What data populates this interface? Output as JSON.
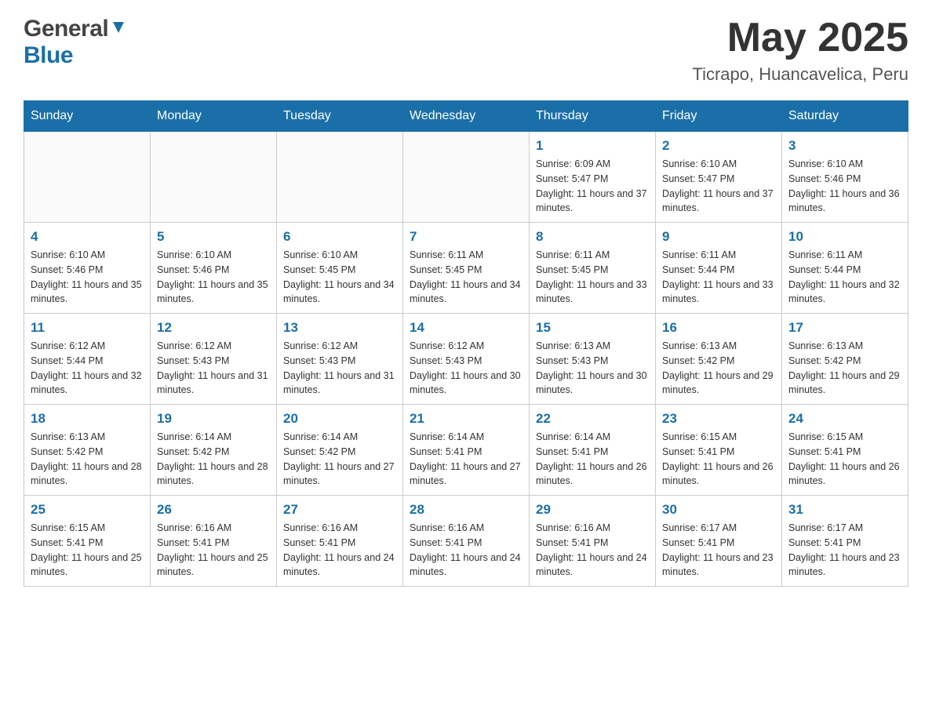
{
  "header": {
    "logo_general": "General",
    "logo_blue": "Blue",
    "month_title": "May 2025",
    "location": "Ticrapo, Huancavelica, Peru"
  },
  "days_of_week": [
    "Sunday",
    "Monday",
    "Tuesday",
    "Wednesday",
    "Thursday",
    "Friday",
    "Saturday"
  ],
  "weeks": [
    [
      {
        "day": "",
        "info": ""
      },
      {
        "day": "",
        "info": ""
      },
      {
        "day": "",
        "info": ""
      },
      {
        "day": "",
        "info": ""
      },
      {
        "day": "1",
        "info": "Sunrise: 6:09 AM\nSunset: 5:47 PM\nDaylight: 11 hours and 37 minutes."
      },
      {
        "day": "2",
        "info": "Sunrise: 6:10 AM\nSunset: 5:47 PM\nDaylight: 11 hours and 37 minutes."
      },
      {
        "day": "3",
        "info": "Sunrise: 6:10 AM\nSunset: 5:46 PM\nDaylight: 11 hours and 36 minutes."
      }
    ],
    [
      {
        "day": "4",
        "info": "Sunrise: 6:10 AM\nSunset: 5:46 PM\nDaylight: 11 hours and 35 minutes."
      },
      {
        "day": "5",
        "info": "Sunrise: 6:10 AM\nSunset: 5:46 PM\nDaylight: 11 hours and 35 minutes."
      },
      {
        "day": "6",
        "info": "Sunrise: 6:10 AM\nSunset: 5:45 PM\nDaylight: 11 hours and 34 minutes."
      },
      {
        "day": "7",
        "info": "Sunrise: 6:11 AM\nSunset: 5:45 PM\nDaylight: 11 hours and 34 minutes."
      },
      {
        "day": "8",
        "info": "Sunrise: 6:11 AM\nSunset: 5:45 PM\nDaylight: 11 hours and 33 minutes."
      },
      {
        "day": "9",
        "info": "Sunrise: 6:11 AM\nSunset: 5:44 PM\nDaylight: 11 hours and 33 minutes."
      },
      {
        "day": "10",
        "info": "Sunrise: 6:11 AM\nSunset: 5:44 PM\nDaylight: 11 hours and 32 minutes."
      }
    ],
    [
      {
        "day": "11",
        "info": "Sunrise: 6:12 AM\nSunset: 5:44 PM\nDaylight: 11 hours and 32 minutes."
      },
      {
        "day": "12",
        "info": "Sunrise: 6:12 AM\nSunset: 5:43 PM\nDaylight: 11 hours and 31 minutes."
      },
      {
        "day": "13",
        "info": "Sunrise: 6:12 AM\nSunset: 5:43 PM\nDaylight: 11 hours and 31 minutes."
      },
      {
        "day": "14",
        "info": "Sunrise: 6:12 AM\nSunset: 5:43 PM\nDaylight: 11 hours and 30 minutes."
      },
      {
        "day": "15",
        "info": "Sunrise: 6:13 AM\nSunset: 5:43 PM\nDaylight: 11 hours and 30 minutes."
      },
      {
        "day": "16",
        "info": "Sunrise: 6:13 AM\nSunset: 5:42 PM\nDaylight: 11 hours and 29 minutes."
      },
      {
        "day": "17",
        "info": "Sunrise: 6:13 AM\nSunset: 5:42 PM\nDaylight: 11 hours and 29 minutes."
      }
    ],
    [
      {
        "day": "18",
        "info": "Sunrise: 6:13 AM\nSunset: 5:42 PM\nDaylight: 11 hours and 28 minutes."
      },
      {
        "day": "19",
        "info": "Sunrise: 6:14 AM\nSunset: 5:42 PM\nDaylight: 11 hours and 28 minutes."
      },
      {
        "day": "20",
        "info": "Sunrise: 6:14 AM\nSunset: 5:42 PM\nDaylight: 11 hours and 27 minutes."
      },
      {
        "day": "21",
        "info": "Sunrise: 6:14 AM\nSunset: 5:41 PM\nDaylight: 11 hours and 27 minutes."
      },
      {
        "day": "22",
        "info": "Sunrise: 6:14 AM\nSunset: 5:41 PM\nDaylight: 11 hours and 26 minutes."
      },
      {
        "day": "23",
        "info": "Sunrise: 6:15 AM\nSunset: 5:41 PM\nDaylight: 11 hours and 26 minutes."
      },
      {
        "day": "24",
        "info": "Sunrise: 6:15 AM\nSunset: 5:41 PM\nDaylight: 11 hours and 26 minutes."
      }
    ],
    [
      {
        "day": "25",
        "info": "Sunrise: 6:15 AM\nSunset: 5:41 PM\nDaylight: 11 hours and 25 minutes."
      },
      {
        "day": "26",
        "info": "Sunrise: 6:16 AM\nSunset: 5:41 PM\nDaylight: 11 hours and 25 minutes."
      },
      {
        "day": "27",
        "info": "Sunrise: 6:16 AM\nSunset: 5:41 PM\nDaylight: 11 hours and 24 minutes."
      },
      {
        "day": "28",
        "info": "Sunrise: 6:16 AM\nSunset: 5:41 PM\nDaylight: 11 hours and 24 minutes."
      },
      {
        "day": "29",
        "info": "Sunrise: 6:16 AM\nSunset: 5:41 PM\nDaylight: 11 hours and 24 minutes."
      },
      {
        "day": "30",
        "info": "Sunrise: 6:17 AM\nSunset: 5:41 PM\nDaylight: 11 hours and 23 minutes."
      },
      {
        "day": "31",
        "info": "Sunrise: 6:17 AM\nSunset: 5:41 PM\nDaylight: 11 hours and 23 minutes."
      }
    ]
  ]
}
